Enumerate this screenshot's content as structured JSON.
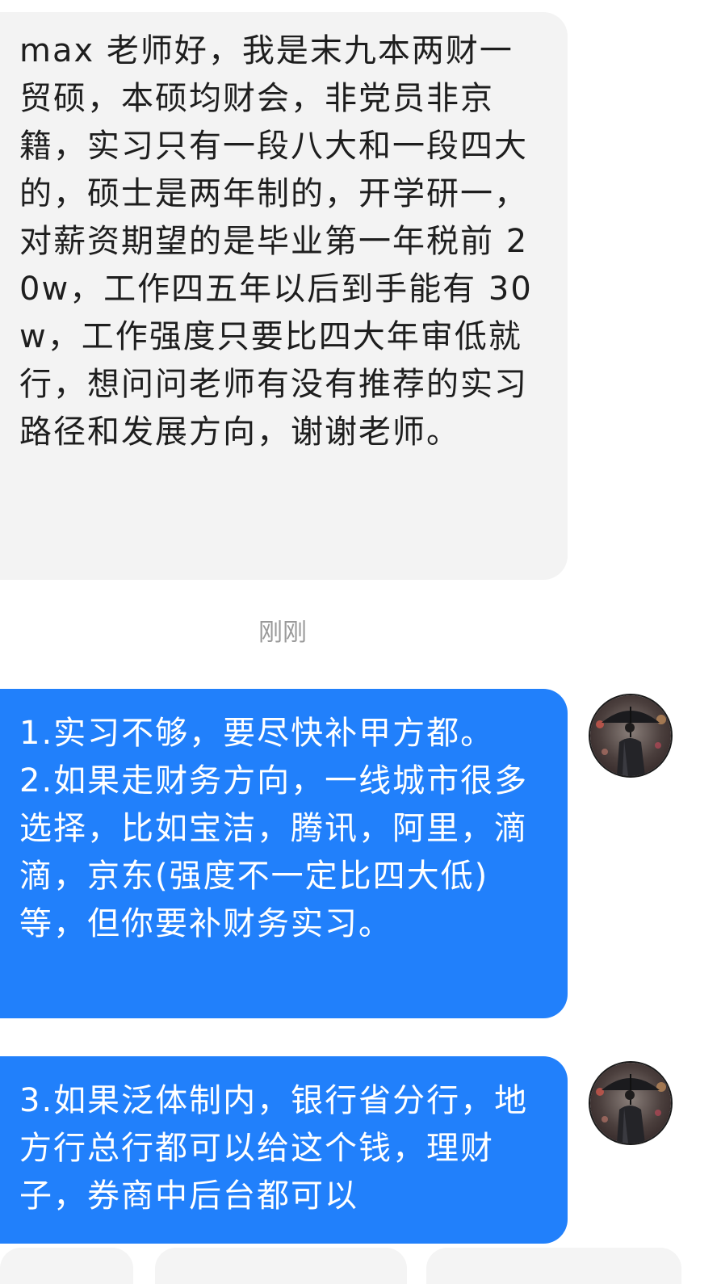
{
  "messages": [
    {
      "direction": "incoming",
      "text": "max 老师好，我是末九本两财一贸硕，本硕均财会，非党员非京籍，实习只有一段八大和一段四大的，硕士是两年制的，开学研一，对薪资期望的是毕业第一年税前 20w，工作四五年以后到手能有 30w，工作强度只要比四大年审低就行，想问问老师有没有推荐的实习路径和发展方向，谢谢老师。"
    },
    {
      "direction": "outgoing",
      "text": "1.实习不够，要尽快补甲方都。\n2.如果走财务方向，一线城市很多选择，比如宝洁，腾讯，阿里，滴滴，京东(强度不一定比四大低)等，但你要补财务实习。"
    },
    {
      "direction": "outgoing",
      "text": "3.如果泛体制内，银行省分行，地方行总行都可以给这个钱，理财子，券商中后台都可以"
    }
  ],
  "timestamp": "刚刚",
  "avatar_icon": "person-with-umbrella-avatar",
  "colors": {
    "incoming_bubble": "#f3f3f3",
    "outgoing_bubble": "#2180fb",
    "timestamp_text": "#9a9a9a",
    "background": "#ffffff"
  }
}
